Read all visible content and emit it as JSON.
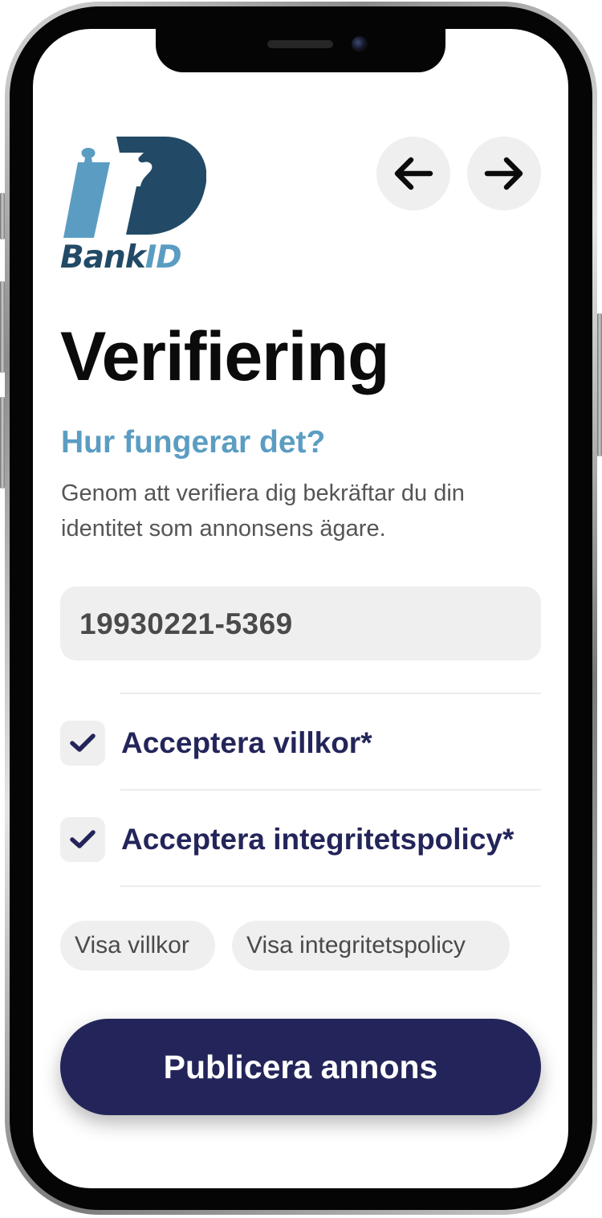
{
  "brand": {
    "bank_text": "Bank",
    "id_text": "ID",
    "dark_color": "#224a66",
    "light_color": "#5b9dc2"
  },
  "navigation": {
    "back_icon": "arrow-left-icon",
    "forward_icon": "arrow-right-icon"
  },
  "page": {
    "title": "Verifiering",
    "subtitle": "Hur fungerar det?",
    "description": "Genom att verifiera dig bekräftar du din identitet som annonsens ägare."
  },
  "personal_number": {
    "value": "19930221-5369"
  },
  "checkboxes": [
    {
      "label": "Acceptera villkor*",
      "checked": true,
      "icon": "checkmark-icon"
    },
    {
      "label": "Acceptera integritetspolicy*",
      "checked": true,
      "icon": "checkmark-icon"
    }
  ],
  "chips": {
    "terms": "Visa villkor",
    "privacy": "Visa integritetspolicy"
  },
  "publish_button": {
    "label": "Publicera annons"
  },
  "colors": {
    "accent_navy": "#23255a",
    "accent_blue": "#5b9dc2",
    "field_bg": "#efefef"
  }
}
